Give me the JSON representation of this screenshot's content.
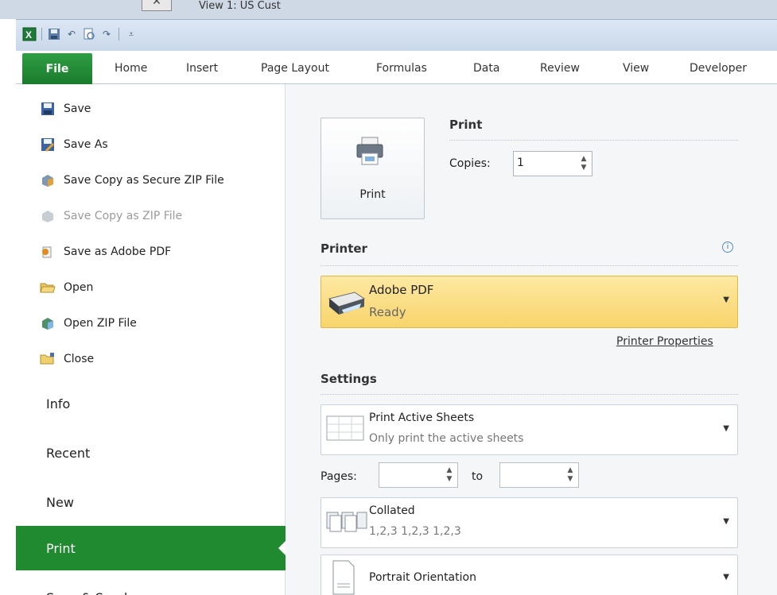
{
  "background_window": {
    "title": "View 1: US Cust"
  },
  "quick_access": {
    "icons": [
      "excel-icon",
      "save-icon",
      "undo-icon",
      "print-preview-icon",
      "redo-icon",
      "customize-icon"
    ]
  },
  "ribbon": {
    "file_tab": "File",
    "tabs": [
      "Home",
      "Insert",
      "Page Layout",
      "Formulas",
      "Data",
      "Review",
      "View",
      "Developer"
    ]
  },
  "backstage": {
    "commands": [
      {
        "label": "Save",
        "icon": "save-icon",
        "enabled": true
      },
      {
        "label": "Save As",
        "icon": "save-as-icon",
        "enabled": true
      },
      {
        "label": "Save Copy as Secure ZIP File",
        "icon": "secure-zip-icon",
        "enabled": true
      },
      {
        "label": "Save Copy as ZIP File",
        "icon": "zip-icon",
        "enabled": false
      },
      {
        "label": "Save as Adobe PDF",
        "icon": "pdf-icon",
        "enabled": true
      },
      {
        "label": "Open",
        "icon": "open-folder-icon",
        "enabled": true
      },
      {
        "label": "Open ZIP File",
        "icon": "open-zip-icon",
        "enabled": true
      },
      {
        "label": "Close",
        "icon": "close-folder-icon",
        "enabled": true
      }
    ],
    "nav": [
      "Info",
      "Recent",
      "New",
      "Print",
      "Save & Send"
    ],
    "selected_nav": "Print"
  },
  "print": {
    "button_label": "Print",
    "section_title": "Print",
    "copies_label": "Copies:",
    "copies_value": "1",
    "printer_title": "Printer",
    "printer_name": "Adobe PDF",
    "printer_status": "Ready",
    "printer_properties": "Printer Properties",
    "settings_title": "Settings",
    "sheets_title": "Print Active Sheets",
    "sheets_sub": "Only print the active sheets",
    "pages_label": "Pages:",
    "to_label": "to",
    "collated_title": "Collated",
    "collated_sub": "1,2,3   1,2,3   1,2,3",
    "orientation_title": "Portrait Orientation"
  },
  "colors": {
    "file_green": "#1f8a2f",
    "printer_highlight": "#f8d46b"
  }
}
